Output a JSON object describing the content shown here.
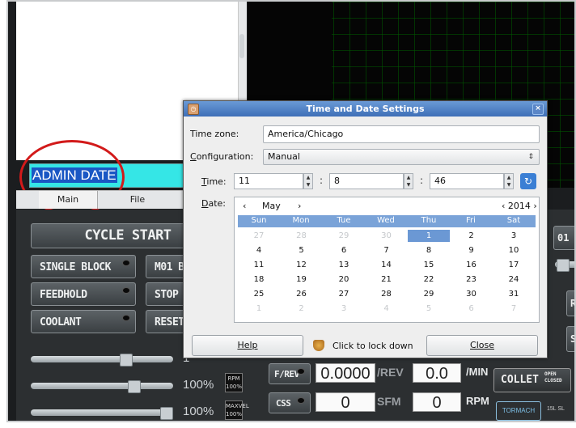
{
  "command_field": {
    "value": "ADMIN DATE"
  },
  "tabs": [
    {
      "label": "Main"
    },
    {
      "label": "File"
    }
  ],
  "panel": {
    "cycle_start": "CYCLE START",
    "buttons": [
      "SINGLE BLOCK",
      "M01 BR",
      "FEEDHOLD",
      "STOP",
      "COOLANT",
      "RESET"
    ],
    "partial_right": [
      "01",
      "R",
      "S"
    ],
    "override_pct": [
      "1",
      "100%",
      "100%"
    ],
    "tag_rpm": "RPM 100%",
    "tag_maxvel": "MAXVEL 100%",
    "fpr_label": "F/REV",
    "fpr_value": "0.0000",
    "rev_unit": "/REV",
    "feed_value": "0.0",
    "min_unit": "/MIN",
    "css_label": "CSS",
    "sfm_value": "0",
    "sfm_unit": "SFM",
    "rpm_value": "0",
    "rpm_unit": "RPM",
    "collet_label": "COLLET",
    "collet_states": "OPEN CLOSED",
    "logo_text": "TORMACH",
    "brand_text": "15L SL"
  },
  "dialog": {
    "title": "Time and Date Settings",
    "timezone_label": "Time zone:",
    "timezone_value": "America/Chicago",
    "config_label": "Configuration:",
    "config_value": "Manual",
    "time_label": "Time:",
    "hour": "11",
    "minute": "8",
    "second": "46",
    "colon": ":",
    "date_label": "Date:",
    "month_prev": "‹",
    "month": "May",
    "month_next": "›",
    "year": "‹ 2014 ›",
    "weekdays": [
      "Sun",
      "Mon",
      "Tue",
      "Wed",
      "Thu",
      "Fri",
      "Sat"
    ],
    "days": [
      [
        "27",
        "28",
        "29",
        "30",
        "1",
        "2",
        "3"
      ],
      [
        "4",
        "5",
        "6",
        "7",
        "8",
        "9",
        "10"
      ],
      [
        "11",
        "12",
        "13",
        "14",
        "15",
        "16",
        "17"
      ],
      [
        "18",
        "19",
        "20",
        "21",
        "22",
        "23",
        "24"
      ],
      [
        "25",
        "26",
        "27",
        "28",
        "29",
        "30",
        "31"
      ],
      [
        "1",
        "2",
        "3",
        "4",
        "5",
        "6",
        "7"
      ]
    ],
    "selected_day": "1",
    "help_button": "Help",
    "lock_text": "Click to lock down",
    "close_button": "Close"
  },
  "colors": {
    "titlebar": "#4a7ec6",
    "highlight": "#6b98d4",
    "command_bg": "#35e6e6",
    "annotation": "#d21a1a"
  }
}
